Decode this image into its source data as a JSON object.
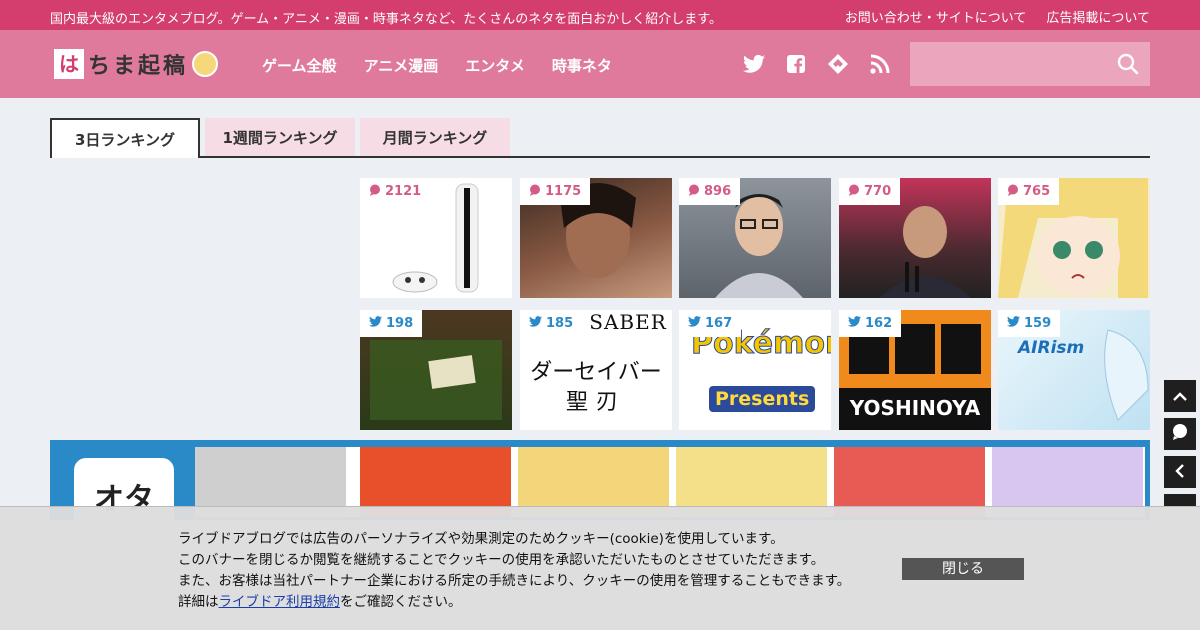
{
  "topbar": {
    "tagline": "国内最大級のエンタメブログ。ゲーム・アニメ・漫画・時事ネタなど、たくさんのネタを面白おかしく紹介します。",
    "links": [
      "お問い合わせ・サイトについて",
      "広告掲載について"
    ]
  },
  "header": {
    "logo_mark": "は",
    "logo_text": "ちま起稿",
    "nav": [
      "ゲーム全般",
      "アニメ漫画",
      "エンタメ",
      "時事ネタ"
    ],
    "social_icons": [
      "twitter-icon",
      "facebook-icon",
      "feedly-icon",
      "rss-icon"
    ],
    "search_placeholder": ""
  },
  "tabs": [
    {
      "label": "3日ランキング",
      "active": true
    },
    {
      "label": "1週間ランキング",
      "active": false
    },
    {
      "label": "月間ランキング",
      "active": false
    }
  ],
  "rankings": {
    "comments": [
      {
        "count": "2121",
        "icon": "comment-icon",
        "color": "#ffffff"
      },
      {
        "count": "1175",
        "icon": "comment-icon",
        "color": "#6b4a3a"
      },
      {
        "count": "896",
        "icon": "comment-icon",
        "color": "#7a7f88"
      },
      {
        "count": "770",
        "icon": "comment-icon",
        "color": "#4a3a3e"
      },
      {
        "count": "765",
        "icon": "comment-icon",
        "color": "#f2e6a8"
      }
    ],
    "tweets": [
      {
        "count": "198",
        "icon": "twitter-icon",
        "color": "#3d3a24"
      },
      {
        "count": "185",
        "icon": "twitter-icon",
        "color": "#ffffff",
        "saber": "SABER",
        "line1": "ダーセイバー",
        "line2": "聖刃"
      },
      {
        "count": "167",
        "icon": "twitter-icon",
        "color": "#ffffff",
        "pk_top": "Pokémon",
        "pk_btm": "Presents"
      },
      {
        "count": "162",
        "icon": "twitter-icon",
        "color": "#f08a1c",
        "brand": "YOSHINOYA"
      },
      {
        "count": "159",
        "icon": "twitter-icon",
        "color": "#d7ecf7",
        "brand": "AIRism"
      }
    ]
  },
  "otanews": {
    "logo_text": "オタ",
    "thumbs": [
      "#cfcfcf",
      "#e84f2b",
      "#f3d67a",
      "#f5e08a",
      "#e85b55",
      "#d8c5f0"
    ]
  },
  "side_buttons": [
    "chevron-up-icon",
    "comment-icon",
    "chevron-left-icon"
  ],
  "cookie": {
    "line1": "ライブドアブログでは広告のパーソナライズや効果測定のためクッキー(cookie)を使用しています。",
    "line2": "このバナーを閉じるか閲覧を継続することでクッキーの使用を承認いただいたものとさせていただきます。",
    "line3": "また、お客様は当社パートナー企業における所定の手続きにより、クッキーの使用を管理することもできます。",
    "line4_pre": "詳細は",
    "line4_link": "ライブドア利用規約",
    "line4_post": "をご確認ください。",
    "close_label": "閉じる"
  }
}
